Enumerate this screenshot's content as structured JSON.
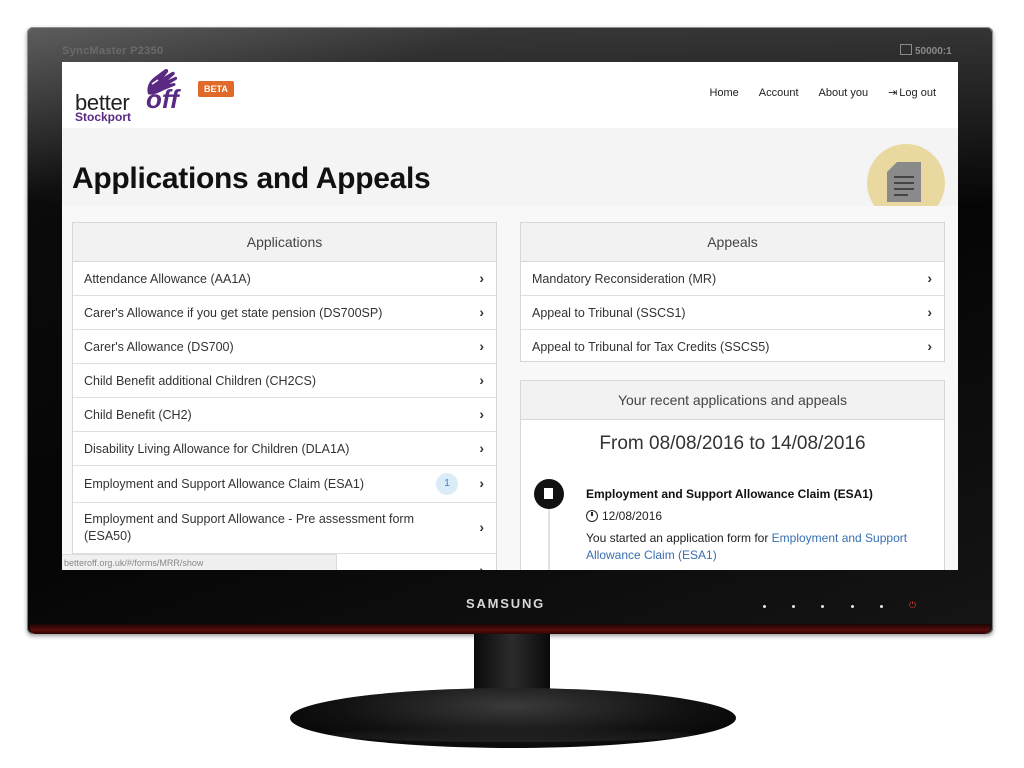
{
  "monitor": {
    "model": "SyncMaster P2350",
    "contrast": "50000:1",
    "brand": "SAMSUNG"
  },
  "site": {
    "logo": {
      "better": "better",
      "off": "off",
      "stockport": "Stockport"
    },
    "beta": "BETA",
    "nav": [
      {
        "label": "Home"
      },
      {
        "label": "Account"
      },
      {
        "label": "About you"
      },
      {
        "label": "Log out",
        "icon": "logout-icon"
      }
    ]
  },
  "page": {
    "title": "Applications and Appeals",
    "title_icon": "document-icon",
    "title_icon_bg": "#e9d9a0"
  },
  "applications": {
    "heading": "Applications",
    "items": [
      {
        "label": "Attendance Allowance (AA1A)"
      },
      {
        "label": "Carer's Allowance if you get state pension (DS700SP)"
      },
      {
        "label": "Carer's Allowance (DS700)"
      },
      {
        "label": "Child Benefit additional Children (CH2CS)"
      },
      {
        "label": "Child Benefit (CH2)"
      },
      {
        "label": "Disability Living Allowance for Children (DLA1A)"
      },
      {
        "label": "Employment and Support Allowance Claim (ESA1)",
        "badge": "1"
      },
      {
        "label": "Employment and Support Allowance - Pre assessment form (ESA50)"
      }
    ]
  },
  "appeals": {
    "heading": "Appeals",
    "items": [
      {
        "label": "Mandatory Reconsideration (MR)"
      },
      {
        "label": "Appeal to Tribunal (SSCS1)"
      },
      {
        "label": "Appeal to Tribunal for Tax Credits (SSCS5)"
      }
    ]
  },
  "recent": {
    "heading": "Your recent applications and appeals",
    "date_range": "From 08/08/2016 to 14/08/2016",
    "entries": [
      {
        "title": "Employment and Support Allowance Claim (ESA1)",
        "date": "12/08/2016",
        "text": "You started an application form for ",
        "link": "Employment and Support Allowance Claim (ESA1)"
      }
    ]
  },
  "status_bar": "betteroff.org.uk/#/forms/MRR/show"
}
